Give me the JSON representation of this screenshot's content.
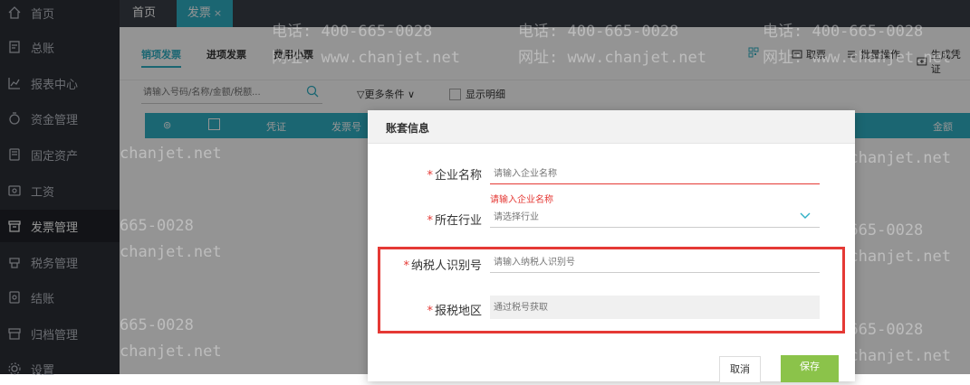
{
  "sidebar": {
    "items": [
      {
        "label": "首页",
        "icon": "home-icon"
      },
      {
        "label": "总账",
        "icon": "ledger-icon"
      },
      {
        "label": "报表中心",
        "icon": "chart-icon"
      },
      {
        "label": "资金管理",
        "icon": "money-icon"
      },
      {
        "label": "固定资产",
        "icon": "asset-icon"
      },
      {
        "label": "工资",
        "icon": "salary-icon"
      },
      {
        "label": "发票管理",
        "icon": "invoice-icon"
      },
      {
        "label": "税务管理",
        "icon": "tax-icon"
      },
      {
        "label": "结账",
        "icon": "close-account-icon"
      },
      {
        "label": "归档管理",
        "icon": "archive-icon"
      },
      {
        "label": "设置",
        "icon": "gear-icon"
      }
    ],
    "active": "发票管理"
  },
  "tabs": {
    "home": "首页",
    "invoice": "发票",
    "close": "×"
  },
  "subtabs": [
    "销项发票",
    "进项发票",
    "费用小票"
  ],
  "toolbar": {
    "fetch": "取票",
    "batch": "批量操作",
    "generate": "生成凭证"
  },
  "search": {
    "placeholder": "请输入号码/名称/金额/税额..."
  },
  "filter": {
    "label": "更多条件"
  },
  "show_detail": {
    "label": "显示明细"
  },
  "table": {
    "headers": [
      "凭证",
      "发票号",
      "金额"
    ]
  },
  "watermark": {
    "phone": "电话: 400-665-0028",
    "site": "网址: www.chanjet.net",
    "phone_fragment": "665-0028",
    "site_fragment": "chanjet.net"
  },
  "modal": {
    "title": "账套信息",
    "fields": {
      "company": {
        "label": "企业名称",
        "placeholder": "请输入企业名称",
        "error": "请输入企业名称"
      },
      "industry": {
        "label": "所在行业",
        "placeholder": "请选择行业"
      },
      "taxid": {
        "label": "纳税人识别号",
        "placeholder": "请输入纳税人识别号"
      },
      "region": {
        "label": "报税地区",
        "placeholder": "通过税号获取"
      }
    },
    "required_mark": "*",
    "buttons": {
      "cancel": "取消",
      "save": "保存"
    }
  },
  "colors": {
    "accent": "#2fb0c5",
    "sidebar_bg": "#2b2f36",
    "error": "#e53935",
    "save": "#8bc34a"
  }
}
